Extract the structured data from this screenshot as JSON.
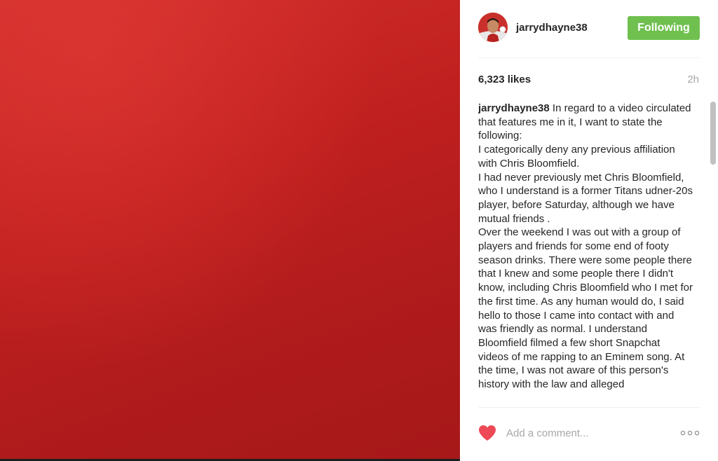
{
  "post": {
    "username": "jarrydhayne38",
    "follow_label": "Following",
    "likes": "6,323 likes",
    "time": "2h",
    "caption_user": "jarrydhayne38",
    "caption_text": "In regard to a video circulated that features me in it, I want to state the following:\nI categorically deny any previous affiliation with Chris Bloomfield.\nI had never previously met Chris Bloomfield, who I understand is a former Titans udner-20s player, before Saturday, although we have mutual friends .\nOver the weekend I was out with a group of players and friends for some end of footy season drinks. There were some people there that I knew and some people there I didn't know, including Chris Bloomfield who I met for the first time. As any human would do, I said hello to those I came into contact with and was friendly as normal. I understand Bloomfield filmed a few short Snapchat videos of me rapping to an Eminem song. At the time, I was not aware of this person's history with the law and alleged"
  },
  "comment": {
    "placeholder": "Add a comment..."
  },
  "colors": {
    "media_red": "#c0201f",
    "follow_green": "#70c050",
    "heart_red": "#ed4956",
    "muted_text": "#a5a7aa"
  },
  "icons": {
    "avatar": "profile-photo",
    "like": "heart-icon",
    "more": "more-options-icon"
  }
}
